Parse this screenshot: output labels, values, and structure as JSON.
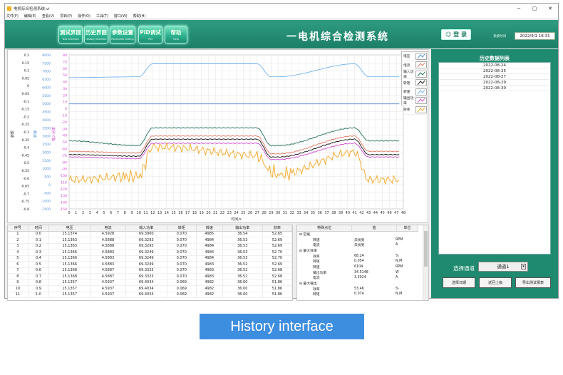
{
  "window": {
    "title": "电机综合检测系统.vi",
    "controls": {
      "minimize": "−",
      "maximize": "▢",
      "close": "✕"
    }
  },
  "menu": [
    "文件(F)",
    "编辑(E)",
    "查看(V)",
    "项目(P)",
    "操作(O)",
    "工具(T)",
    "窗口(W)",
    "帮助(H)"
  ],
  "nav": [
    {
      "zh": "测试界面",
      "en": "Test interface"
    },
    {
      "zh": "历史界面",
      "en": "History interface"
    },
    {
      "zh": "参数设置",
      "en": "Parameter setting"
    },
    {
      "zh": "PID调试",
      "en": "PID"
    },
    {
      "zh": "帮助",
      "en": "Help"
    }
  ],
  "header": {
    "system_title": "一电机综合检测系统",
    "login_label": "登 录",
    "sys_time_label": "系统时间",
    "sys_time": "2022/9/1 18:31"
  },
  "chart_data": {
    "type": "line",
    "xlabel": "时间/s",
    "x_ticks": [
      0,
      1,
      2,
      3,
      4,
      5,
      6,
      7,
      8,
      9,
      10,
      11,
      12,
      13,
      14,
      15,
      16,
      17,
      18,
      19,
      20,
      21,
      22,
      23,
      24,
      25,
      26,
      27,
      28,
      29,
      30,
      31,
      32,
      33,
      34,
      35,
      36,
      37,
      38,
      39,
      40,
      41,
      42,
      43,
      44,
      45,
      46,
      47,
      48
    ],
    "xlim": [
      0,
      48
    ],
    "y_axes": [
      {
        "label": "转矩",
        "ylim": [
          -0.8,
          0.2
        ],
        "ticks": [
          "0.2",
          "0.15",
          "0.1",
          "0.05",
          "0",
          "-0.05",
          "-0.1",
          "-0.15",
          "-0.2",
          "-0.25",
          "-0.3",
          "-0.35",
          "-0.4",
          "-0.45",
          "-0.5",
          "-0.55",
          "-0.6",
          "-0.65",
          "-0.7",
          "-0.75",
          "-0.8"
        ]
      },
      {
        "label": "转速",
        "ylim": [
          -1500,
          8000
        ],
        "ticks": [
          "8000",
          "7500",
          "7000",
          "6500",
          "6000",
          "5500",
          "5000",
          "4500",
          "4000",
          "3500",
          "3000",
          "2500",
          "2000",
          "1500",
          "1000",
          "500",
          "0",
          "-500",
          "-1000",
          "-1500"
        ]
      },
      {
        "label": "输入功率",
        "ylim": [
          -150,
          80
        ],
        "ticks": [
          "80",
          "70",
          "60",
          "50",
          "40",
          "30",
          "20",
          "10",
          "0",
          "-10",
          "-20",
          "-30",
          "-40",
          "-50",
          "-60",
          "-70",
          "-80",
          "-90",
          "-100",
          "-110",
          "-120",
          "-130",
          "-140",
          "-150"
        ]
      }
    ],
    "series": [
      {
        "name": "电压",
        "color": "#4f8fd8"
      },
      {
        "name": "电流",
        "color": "#e07a62"
      },
      {
        "name": "输入功率",
        "color": "#1d6f57"
      },
      {
        "name": "转矩",
        "color": "#111111"
      },
      {
        "name": "转速",
        "color": "#73b3f0"
      },
      {
        "name": "输出功率",
        "color": "#d24bd2"
      },
      {
        "name": "效率",
        "color": "#f3a520"
      }
    ],
    "profiles": {
      "x": [
        0,
        10,
        12,
        14,
        27,
        29,
        30,
        41,
        43,
        48
      ],
      "转速": [
        6600,
        6650,
        7450,
        7450,
        7450,
        6650,
        6650,
        7450,
        6650,
        6650
      ],
      "电压": [
        4980,
        4980,
        4980,
        4980,
        4980,
        4980,
        4980,
        4980,
        4980,
        4980
      ],
      "输入功率": [
        2700,
        2400,
        3500,
        3500,
        3500,
        2400,
        2400,
        3500,
        2700,
        2700
      ],
      "电流": [
        2050,
        1950,
        3000,
        3000,
        3000,
        1900,
        1900,
        3000,
        2050,
        2050
      ],
      "转矩": [
        1850,
        1750,
        2800,
        2800,
        2800,
        1700,
        1700,
        2800,
        1850,
        1850
      ],
      "输出功率": [
        1700,
        1600,
        2550,
        2550,
        2550,
        1550,
        1550,
        2550,
        1700,
        1700
      ],
      "效率": [
        300,
        500,
        2300,
        2300,
        1800,
        800,
        600,
        2000,
        300,
        300
      ]
    }
  },
  "data_table": {
    "headers": [
      "序号",
      "时间",
      "电压",
      "电流",
      "输入功率",
      "转矩",
      "转速",
      "输出功率",
      "效率"
    ],
    "rows": [
      [
        "1",
        "0.0",
        "15.1374",
        "4.5928",
        "69.3960",
        "0.070",
        "4985",
        "36.54",
        "52.65"
      ],
      [
        "2",
        "0.1",
        "15.1363",
        "4.5888",
        "69.3293",
        "0.070",
        "4984",
        "36.53",
        "52.69"
      ],
      [
        "3",
        "0.2",
        "15.1363",
        "4.5888",
        "69.3293",
        "0.070",
        "4984",
        "36.53",
        "52.69"
      ],
      [
        "4",
        "0.3",
        "15.1366",
        "4.5883",
        "69.3249",
        "0.070",
        "4984",
        "36.53",
        "52.70"
      ],
      [
        "5",
        "0.4",
        "15.1366",
        "4.5883",
        "69.3249",
        "0.070",
        "4984",
        "36.53",
        "52.70"
      ],
      [
        "6",
        "0.5",
        "15.1366",
        "4.5883",
        "69.3249",
        "0.070",
        "4983",
        "36.52",
        "52.69"
      ],
      [
        "7",
        "0.6",
        "15.1368",
        "4.5887",
        "69.3323",
        "0.070",
        "4983",
        "36.52",
        "52.68"
      ],
      [
        "8",
        "0.7",
        "15.1368",
        "4.5887",
        "69.3323",
        "0.070",
        "4983",
        "36.52",
        "52.68"
      ],
      [
        "9",
        "0.8",
        "15.1357",
        "4.5937",
        "69.4034",
        "0.069",
        "4982",
        "36.00",
        "51.86"
      ],
      [
        "10",
        "0.9",
        "15.1357",
        "4.5937",
        "69.4034",
        "0.069",
        "4982",
        "36.00",
        "51.86"
      ],
      [
        "11",
        "1.0",
        "15.1357",
        "4.5937",
        "69.4034",
        "0.069",
        "4982",
        "36.00",
        "51.86"
      ]
    ]
  },
  "feature_table": {
    "headers": [
      "特殊点位",
      "值",
      "单位"
    ],
    "rows": [
      {
        "c1": "空载",
        "c2": "",
        "c3": "",
        "level": 0
      },
      {
        "c1": "转速",
        "c2": "未找到",
        "c3": "RPM",
        "level": 1
      },
      {
        "c1": "电流",
        "c2": "未找到",
        "c3": "A",
        "level": 1
      },
      {
        "c1": "最大效率",
        "c2": "",
        "c3": "",
        "level": 0
      },
      {
        "c1": "效率",
        "c2": "68.24",
        "c3": "%",
        "level": 1
      },
      {
        "c1": "转矩",
        "c2": "0.054",
        "c3": "N.M",
        "level": 1
      },
      {
        "c1": "转速",
        "c2": "6104",
        "c3": "RPM",
        "level": 1
      },
      {
        "c1": "输出功率",
        "c2": "34.5148",
        "c3": "W",
        "level": 1
      },
      {
        "c1": "电流",
        "c2": "3.3024",
        "c3": "A",
        "level": 1
      },
      {
        "c1": "最大输出",
        "c2": "",
        "c3": "",
        "level": 0
      },
      {
        "c1": "效率",
        "c2": "53.46",
        "c3": "%",
        "level": 1
      },
      {
        "c1": "转矩",
        "c2": "0.074",
        "c3": "N.M",
        "level": 1
      }
    ]
  },
  "history": {
    "title": "历史数据列表",
    "items": [
      "2022-08-24",
      "2022-08-25",
      "2022-08-27",
      "2022-08-29",
      "2022-08-30"
    ],
    "channel_label": "选择通道",
    "channel_value": "通道1",
    "buttons": [
      "选择日期",
      "返回上级",
      "导出测试报表"
    ]
  },
  "caption": "History interface"
}
